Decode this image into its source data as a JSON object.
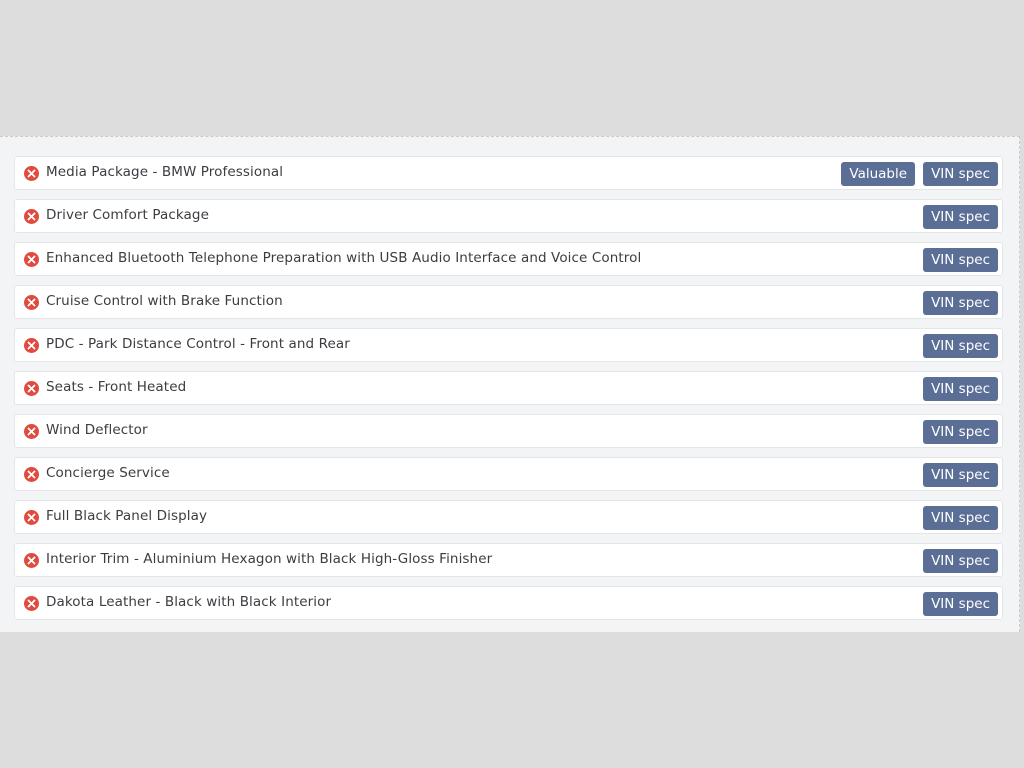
{
  "options": {
    "items": [
      {
        "label": "Media Package - BMW Professional",
        "badges": [
          "Valuable",
          "VIN spec"
        ]
      },
      {
        "label": "Driver Comfort Package",
        "badges": [
          "VIN spec"
        ]
      },
      {
        "label": "Enhanced Bluetooth Telephone Preparation with USB Audio Interface and Voice Control",
        "badges": [
          "VIN spec"
        ]
      },
      {
        "label": "Cruise Control with Brake Function",
        "badges": [
          "VIN spec"
        ]
      },
      {
        "label": "PDC - Park Distance Control - Front and Rear",
        "badges": [
          "VIN spec"
        ]
      },
      {
        "label": "Seats - Front Heated",
        "badges": [
          "VIN spec"
        ]
      },
      {
        "label": "Wind Deflector",
        "badges": [
          "VIN spec"
        ]
      },
      {
        "label": "Concierge Service",
        "badges": [
          "VIN spec"
        ]
      },
      {
        "label": "Full Black Panel Display",
        "badges": [
          "VIN spec"
        ]
      },
      {
        "label": "Interior Trim - Aluminium Hexagon with Black High-Gloss Finisher",
        "badges": [
          "VIN spec"
        ]
      },
      {
        "label": "Dakota Leather - Black with Black Interior",
        "badges": [
          "VIN spec"
        ]
      }
    ],
    "status_icon": "x-circle-icon",
    "colors": {
      "status_icon": "#e04a3f",
      "badge_bg": "#5b6e96",
      "badge_text": "#ffffff"
    }
  }
}
